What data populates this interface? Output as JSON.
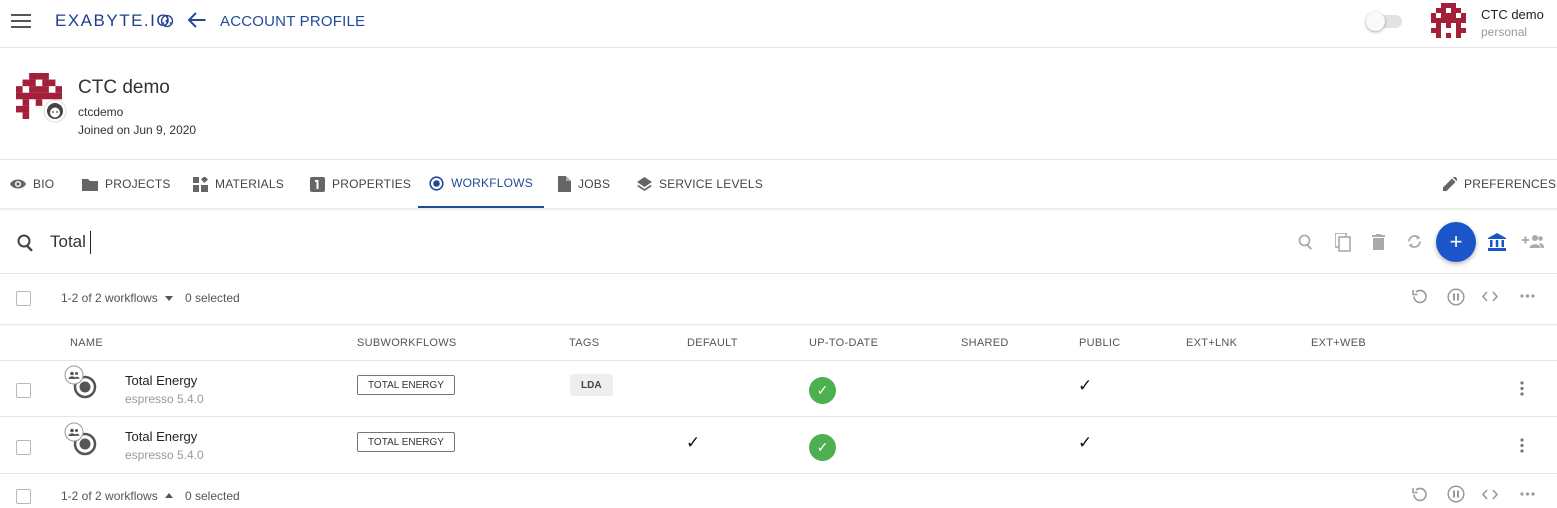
{
  "topbar": {
    "brand": "EXABYTE.IO",
    "page_title": "ACCOUNT PROFILE",
    "user_name": "CTC demo",
    "user_account_type": "personal"
  },
  "profile": {
    "display_name": "CTC demo",
    "username": "ctcdemo",
    "joined": "Joined on Jun 9, 2020"
  },
  "tabs": [
    {
      "label": "BIO",
      "icon": "eye-icon"
    },
    {
      "label": "PROJECTS",
      "icon": "folder-icon"
    },
    {
      "label": "MATERIALS",
      "icon": "materials-icon"
    },
    {
      "label": "PROPERTIES",
      "icon": "properties-icon"
    },
    {
      "label": "WORKFLOWS",
      "icon": "workflows-icon",
      "active": true
    },
    {
      "label": "JOBS",
      "icon": "document-icon"
    },
    {
      "label": "SERVICE LEVELS",
      "icon": "layers-icon"
    },
    {
      "label": "PREFERENCES",
      "icon": "pencil-icon"
    }
  ],
  "search": {
    "value": "Total"
  },
  "pager_top": {
    "range": "1-2 of 2 workflows",
    "selected": "0 selected"
  },
  "pager_bottom": {
    "range": "1-2 of 2 workflows",
    "selected": "0 selected"
  },
  "table": {
    "columns": [
      "NAME",
      "SUBWORKFLOWS",
      "TAGS",
      "DEFAULT",
      "UP-TO-DATE",
      "SHARED",
      "PUBLIC",
      "EXT+LNK",
      "EXT+WEB"
    ],
    "rows": [
      {
        "name": "Total Energy",
        "application": "espresso 5.4.0",
        "subworkflow": "TOTAL ENERGY",
        "tag": "LDA",
        "default": false,
        "up_to_date": true,
        "shared": false,
        "public": true
      },
      {
        "name": "Total Energy",
        "application": "espresso 5.4.0",
        "subworkflow": "TOTAL ENERGY",
        "tag": "",
        "default": true,
        "up_to_date": true,
        "shared": false,
        "public": true
      }
    ]
  },
  "colors": {
    "brand_blue": "#1f4a9a",
    "fab_blue": "#1a56c7",
    "success_green": "#4caf50",
    "avatar_red": "#a3203a"
  },
  "icons": {
    "check_glyph": "✓",
    "plus_glyph": "+"
  }
}
